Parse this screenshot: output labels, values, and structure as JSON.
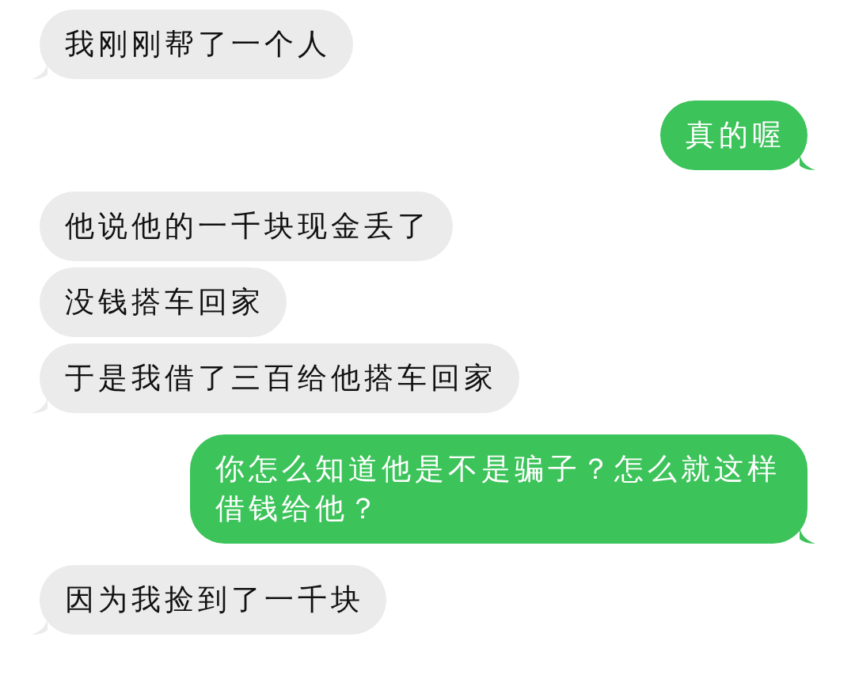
{
  "messages": [
    {
      "kind": "incoming",
      "text": "我刚刚帮了一个人",
      "tail": true
    },
    {
      "kind": "outgoing",
      "text": "真的喔",
      "tail": true
    },
    {
      "kind": "incoming",
      "text": "他说他的一千块现金丢了",
      "tail": false
    },
    {
      "kind": "incoming",
      "text": "没钱搭车回家",
      "tail": false
    },
    {
      "kind": "incoming",
      "text": "于是我借了三百给他搭车回家",
      "tail": true
    },
    {
      "kind": "outgoing",
      "text": "你怎么知道他是不是骗子？怎么就这样借钱给他？",
      "tail": true
    },
    {
      "kind": "incoming",
      "text": "因为我捡到了一千块",
      "tail": true
    }
  ]
}
